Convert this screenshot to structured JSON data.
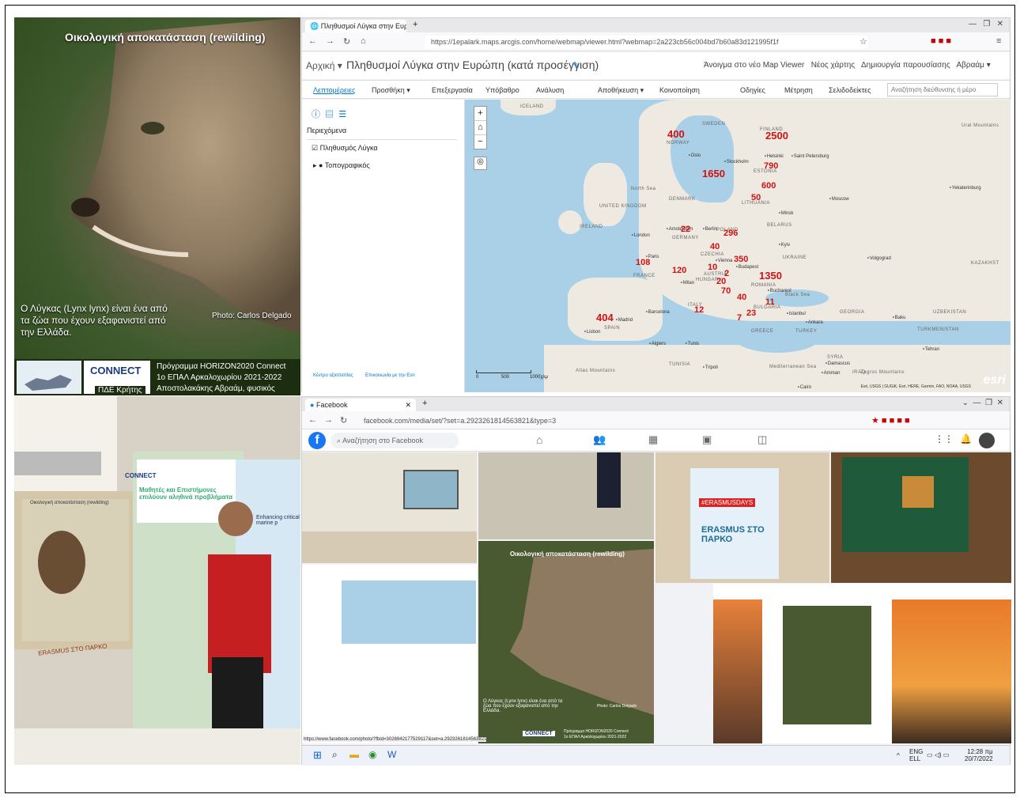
{
  "poster": {
    "title": "Οικολογική αποκατάσταση (rewilding)",
    "subtitle": "Ο Λύγκας (Lynx lynx) είναι ένα από τα ζώα που έχουν εξαφανιστεί από την Ελλάδα.",
    "photo_credit": "Photo: Carlos Delgado",
    "logo_text": "CONNECT",
    "program_line1": "Πρόγραμμα HORIZON2020 Connect",
    "program_line2": "1ο ΕΠΑΛ Αρκαλοχωρίου 2021-2022",
    "program_line3": "Αποστολακάκης Αβραάμ, φυσικός",
    "pde": "ΠΔΕ Κρήτης"
  },
  "arcgis": {
    "tab_title": "Πληθυσμοί Λύγκα στην Ευρώπ",
    "url": "https://1epalark.maps.arcgis.com/home/webmap/viewer.html?webmap=2a223cb56c004bd7b60a83d121995f1f",
    "crumb": "Αρχική ▾",
    "map_title": "Πληθυσμοί Λύγκα στην Ευρώπη (κατά προσέγγιση)",
    "header_links": [
      "Άνοιγμα στο νέο Map Viewer",
      "Νέος χάρτης",
      "Δημιουργία παρουσίασης",
      "Αβραάμ ▾"
    ],
    "toolbar": [
      "Λεπτομέρειες",
      "Προσθήκη ▾",
      "Επεξεργασία",
      "Υπόβαθρο",
      "Ανάλυση",
      "Αποθήκευση ▾",
      "Κοινοποίηση",
      "Οδηγίες",
      "Μέτρηση",
      "Σελιδοδείκτες"
    ],
    "search_placeholder": "Αναζήτηση διεύθυνσης ή μέρο",
    "contents_label": "Περιεχόμενα",
    "layers": [
      "Πληθυσμός Λύγκα",
      "Τοπογραφικός"
    ],
    "scale": "1000χλμ",
    "scale_mid": "500",
    "scale_zero": "0",
    "attribution": "Esri, USGS | GUGiK, Esri, HERE, Garmin, FAO, NOAA, USGS",
    "footer_left": "Κέντρο αξιοπιστίας",
    "footer_right": "Επικοινωνία με την Esri"
  },
  "lynx_counts": [
    {
      "place": "Norway",
      "value": "400"
    },
    {
      "place": "Finland",
      "value": "2500"
    },
    {
      "place": "Sweden",
      "value": "1650"
    },
    {
      "place": "Estonia",
      "value": "790"
    },
    {
      "place": "Latvia",
      "value": "600"
    },
    {
      "place": "Lithuania",
      "value": "50"
    },
    {
      "place": "Germany",
      "value": "22"
    },
    {
      "place": "Poland",
      "value": "296"
    },
    {
      "place": "Czechia",
      "value": "40"
    },
    {
      "place": "Slovakia",
      "value": "350"
    },
    {
      "place": "Austria",
      "value": "10"
    },
    {
      "place": "Hungary",
      "value": "2"
    },
    {
      "place": "Romania",
      "value": "1350"
    },
    {
      "place": "France",
      "value": "108"
    },
    {
      "place": "Switzerland",
      "value": "120"
    },
    {
      "place": "Slovenia",
      "value": "20"
    },
    {
      "place": "Croatia",
      "value": "70"
    },
    {
      "place": "Serbia",
      "value": "40"
    },
    {
      "place": "Bulgaria",
      "value": "11"
    },
    {
      "place": "Italy",
      "value": "12"
    },
    {
      "place": "Albania",
      "value": "23"
    },
    {
      "place": "N. Macedonia",
      "value": "7"
    },
    {
      "place": "Spain",
      "value": "404"
    }
  ],
  "map_labels": [
    "ICELAND",
    "SWEDEN",
    "FINLAND",
    "NORWAY",
    "ESTONIA",
    "North Sea",
    "DENMARK",
    "LITHUANIA",
    "UNITED KINGDOM",
    "IRELAND",
    "BELARUS",
    "POLAND",
    "GERMANY",
    "CZECHIA",
    "UKRAINE",
    "AUSTRIA",
    "HUNGARY",
    "FRANCE",
    "ROMANIA",
    "ITALY",
    "BULGARIA",
    "SPAIN",
    "GREECE",
    "TURKEY",
    "GEORGIA",
    "KAZAKHST",
    "UZBEKISTAN",
    "TURKMENISTAN",
    "TUNISIA",
    "SYRIA",
    "IRAQ",
    "Black Sea",
    "Mediterranean Sea",
    "Ural Mountains",
    "Zagros Mountains",
    "Atlas Mountains"
  ],
  "map_cities": [
    "Oslo",
    "Stockholm",
    "Helsinki",
    "Saint Petersburg",
    "Yekaterinburg",
    "Moscow",
    "Minsk",
    "Amsterdam",
    "Berlin",
    "London",
    "Kyiv",
    "Paris",
    "Vienna",
    "Budapest",
    "Volgograd",
    "Milan",
    "Bucharest",
    "Barcelona",
    "Istanbul",
    "Ankara",
    "Baku",
    "Madrid",
    "Lisbon",
    "Algiers",
    "Tunis",
    "Tripoli",
    "Damascus",
    "Amman",
    "Cairo",
    "Tehran"
  ],
  "facebook": {
    "tab_title": "Facebook",
    "url": "facebook.com/media/set/?set=a.2923261814563821&type=3",
    "search_placeholder": "Αναζήτηση στο Facebook",
    "status_url": "https://www.facebook.com/photo/?fbid=3026942177529117&set=a.2923261814563821",
    "tile_poster_title": "Οικολογική αποκατάσταση (rewilding)",
    "tile_poster_text": "Ο Λύγκας (Lynx lynx) είναι ένα από τα ζώα που έχουν εξαφανιστεί από την Ελλάδα.",
    "tile_photo_credit": "Photo: Carlos Delgado",
    "tile_logo": "CONNECT",
    "tile_prog1": "Πρόγραμμα HORIZON2020 Connect",
    "tile_prog2": "1ο ΕΠΑΛ Αρκαλοχωρίου 2021-2022",
    "erasmus_poster": "ERASMUS ΣΤΟ ΠΑΡΚΟ",
    "erasmus_days": "#ERASMUSDAYS",
    "taskbar_lang": "ENG",
    "taskbar_lang2": "ELL",
    "taskbar_time": "12:28 πμ",
    "taskbar_date": "20/7/2022"
  },
  "event_photo": {
    "banner_logo": "CONNECT",
    "banner_text": "Μαθητές και Επιστήμονες επιλύουν αληθινά προβλήματα",
    "poster_heading": "Οικολογική αποκατάσταση (rewilding)",
    "poster_caption": "ERASMUS ΣΤΟ ΠΑΡΚΟ",
    "side_banner": "Enhancing critical marine p"
  },
  "colors": {
    "arcgis_count": "#d11111",
    "facebook_blue": "#1877f2",
    "connect_blue": "#1c3b7c"
  }
}
